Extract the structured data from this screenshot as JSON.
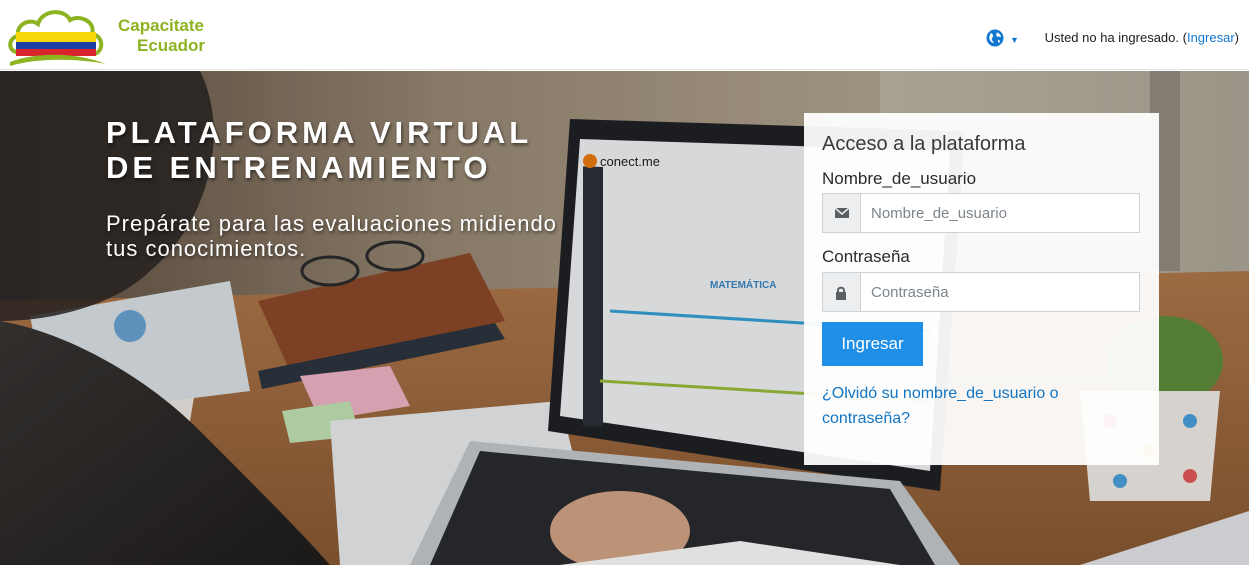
{
  "header": {
    "logo_line1": "Capacitate",
    "logo_line2": "Ecuador",
    "login_status_prefix": "Usted no ha ingresado. (",
    "login_link": "Ingresar",
    "login_status_suffix": ")",
    "language_icon": "globe-icon"
  },
  "hero": {
    "title": "PLATAFORMA VIRTUAL DE ENTRENAMIENTO",
    "subtitle": "Prepárate para las evaluaciones midiendo tus conocimientos."
  },
  "login_card": {
    "title": "Acceso a la plataforma",
    "username_label": "Nombre_de_usuario",
    "username_placeholder": "Nombre_de_usuario",
    "username_icon": "envelope-icon",
    "password_label": "Contraseña",
    "password_placeholder": "Contraseña",
    "password_icon": "lock-icon",
    "submit_label": "Ingresar",
    "forgot_link": "¿Olvidó su nombre_de_usuario o contraseña?"
  },
  "colors": {
    "brand_green": "#8db321",
    "link_blue": "#1177d1",
    "button_blue": "#1f8ee6"
  }
}
